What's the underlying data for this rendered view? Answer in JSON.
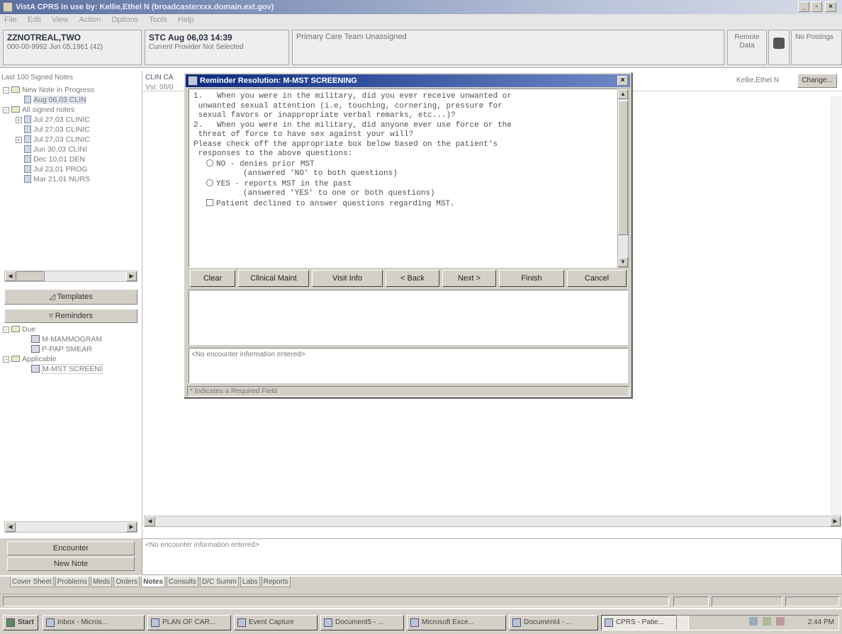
{
  "window": {
    "title": "VistA CPRS in use by: Kellie,Ethel N (broadcasterxxx.domain.ext.gov)"
  },
  "menu": [
    "File",
    "Edit",
    "View",
    "Action",
    "Options",
    "Tools",
    "Help"
  ],
  "header": {
    "patient_name": "ZZNOTREAL,TWO",
    "patient_ssn_dob": "000-00-9992    Jun 05,1961 (42)",
    "location": "STC Aug 06,03 14:39",
    "provider": "Current Provider Not Selected",
    "primary_care": "Primary Care Team Unassigned",
    "remote_data": "Remote Data",
    "postings": "No Postings"
  },
  "notes_panel": {
    "title": "Last 100 Signed Notes",
    "tree": [
      {
        "level": 0,
        "expander": "-",
        "label": "New Note in Progress",
        "icon": "folder"
      },
      {
        "level": 2,
        "label": "Aug 06,03  CLIN",
        "icon": "note"
      },
      {
        "level": 0,
        "expander": "-",
        "label": "All signed notes",
        "icon": "folder"
      },
      {
        "level": 1,
        "expander": "+",
        "label": "Jul 27,03  CLINIC",
        "icon": "note"
      },
      {
        "level": 1,
        "label": "Jul 27,03  CLINIC",
        "icon": "note"
      },
      {
        "level": 1,
        "expander": "+",
        "label": "Jul 27,03  CLINIC",
        "icon": "note"
      },
      {
        "level": 1,
        "label": "Jun 30,03  CLINI",
        "icon": "note"
      },
      {
        "level": 1,
        "label": "Dec 10,01  DEN",
        "icon": "note"
      },
      {
        "level": 1,
        "label": "Jul 23,01  PROG",
        "icon": "note"
      },
      {
        "level": 1,
        "label": "Mar 21,01  NURS",
        "icon": "note"
      }
    ],
    "templates_label": "Templates",
    "reminders_label": "Reminders",
    "reminders_tree": [
      {
        "level": 0,
        "expander": "-",
        "label": "Due",
        "icon": "folder"
      },
      {
        "level": 1,
        "label": "M-MAMMOGRAM",
        "icon": "reminder"
      },
      {
        "level": 1,
        "label": "P-PAP SMEAR",
        "icon": "reminder"
      },
      {
        "level": 0,
        "expander": "-",
        "label": "Applicable",
        "icon": "folder"
      },
      {
        "level": 1,
        "label": "M-MST SCREENI",
        "icon": "reminder"
      }
    ],
    "encounter_btn": "Encounter",
    "new_note_btn": "New Note"
  },
  "note_header": {
    "title": "CLIN CA",
    "visit": "Vst: 08/0",
    "author": "Kellie,Ethel N",
    "change_btn": "Change..."
  },
  "dialog": {
    "title": "Reminder Resolution: M-MST SCREENING",
    "questions_lines": [
      "1.   When you were in the military, did you ever receive unwanted or",
      " unwanted sexual attention (i.e, touching, cornering, pressure for",
      " sexual favors or inappropriate verbal remarks, etc...)?",
      "",
      "2.   When you were in the military, did anyone ever use force or the",
      " threat of force to have sex against your will?",
      "",
      "Please check off the appropriate box below based on the patient's",
      " responses to the above questions:"
    ],
    "options": [
      {
        "label": "NO - denies prior MST",
        "detail": "(answered 'NO' to both questions)",
        "control": "radio"
      },
      {
        "label": "YES - reports MST in the past",
        "detail": "(answered 'YES' to one or both questions)",
        "control": "radio"
      },
      {
        "label": "Patient declined to answer questions regarding MST.",
        "detail": "",
        "control": "checkbox"
      }
    ],
    "buttons": {
      "clear": "Clear",
      "clinical_maint": "Clinical Maint",
      "visit_info": "Visit Info",
      "back": "< Back",
      "next": "Next >",
      "finish": "Finish",
      "cancel": "Cancel"
    },
    "encounter_text": "<No encounter information entered>",
    "required_note": "* Indicates a Required Field"
  },
  "encounter_box": "<No encounter information entered>",
  "tabs": [
    "Cover Sheet",
    "Problems",
    "Meds",
    "Orders",
    "Notes",
    "Consults",
    "D/C Summ",
    "Labs",
    "Reports"
  ],
  "active_tab": "Notes",
  "taskbar": {
    "start": "Start",
    "tasks": [
      "Inbox - Micros...",
      "PLAN OF CAR...",
      "Event Capture",
      "Document5 - ...",
      "Microsoft Exce...",
      "Document4 - ...",
      "CPRS - Patie..."
    ],
    "active_task": "CPRS - Patie...",
    "clock": "2:44 PM"
  }
}
